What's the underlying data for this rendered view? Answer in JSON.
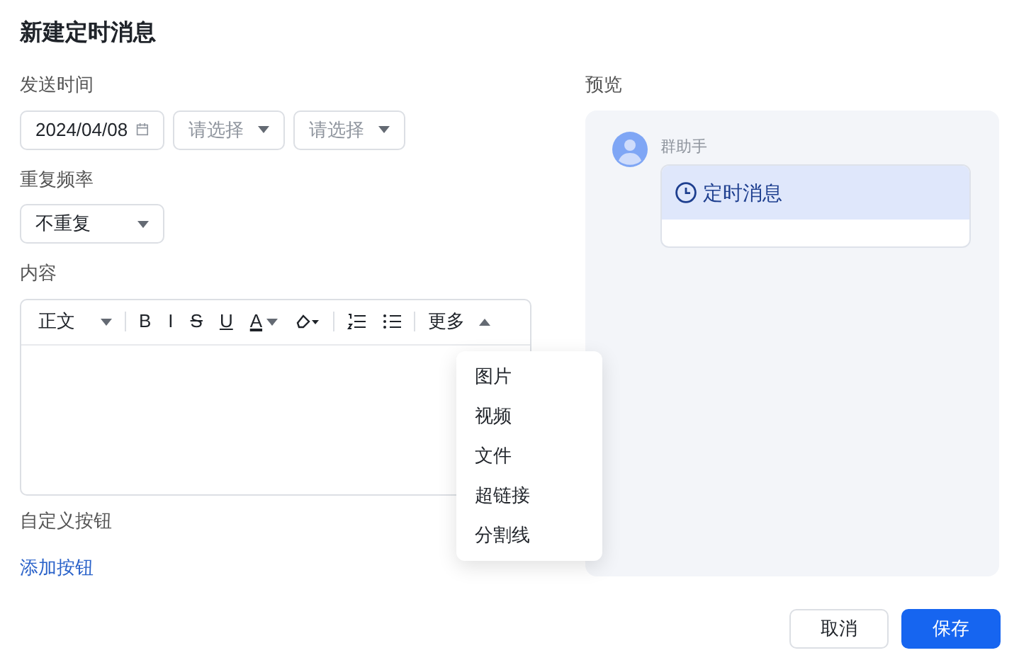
{
  "title": "新建定时消息",
  "send_time": {
    "label": "发送时间",
    "date": "2024/04/08",
    "selects": [
      {
        "placeholder": "请选择"
      },
      {
        "placeholder": "请选择"
      }
    ]
  },
  "repeat": {
    "label": "重复频率",
    "value": "不重复"
  },
  "content": {
    "label": "内容",
    "toolbar": [
      {
        "kind": "style",
        "label": "正文"
      },
      {
        "kind": "bold",
        "label": "B"
      },
      {
        "kind": "italic",
        "label": "I"
      },
      {
        "kind": "strike",
        "label": "S"
      },
      {
        "kind": "underline",
        "label": "U"
      },
      {
        "kind": "color",
        "label": "A"
      },
      {
        "kind": "highlight"
      },
      {
        "kind": "ordered-list"
      },
      {
        "kind": "bullet-list"
      },
      {
        "kind": "more",
        "label": "更多",
        "expanded": true
      }
    ],
    "more_menu": [
      "图片",
      "视频",
      "文件",
      "超链接",
      "分割线"
    ]
  },
  "custom_buttons": {
    "label": "自定义按钮",
    "add_link": "添加按钮"
  },
  "preview": {
    "label": "预览",
    "sender": "群助手",
    "card_title": "定时消息"
  },
  "buttons": [
    {
      "kind": "secondary",
      "label": "取消"
    },
    {
      "kind": "primary",
      "label": "保存"
    }
  ]
}
